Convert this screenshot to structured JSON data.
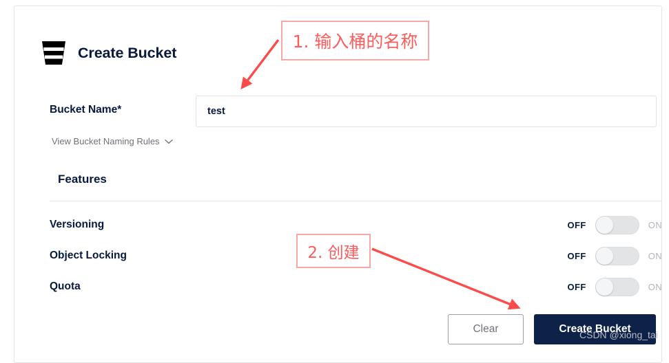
{
  "card": {
    "icon": "bucket-icon",
    "title": "Create Bucket"
  },
  "form": {
    "bucket_name": {
      "label": "Bucket Name*",
      "value": "test",
      "placeholder": ""
    },
    "naming_rules": {
      "label": "View Bucket Naming Rules",
      "chevron": "chevron-down-icon"
    }
  },
  "features": {
    "heading": "Features",
    "rows": [
      {
        "label": "Versioning",
        "off_label": "OFF",
        "on_label": "ON",
        "state": "off"
      },
      {
        "label": "Object Locking",
        "off_label": "OFF",
        "on_label": "ON",
        "state": "off"
      },
      {
        "label": "Quota",
        "off_label": "OFF",
        "on_label": "ON",
        "state": "off"
      }
    ]
  },
  "actions": {
    "clear_label": "Clear",
    "create_label": "Create Bucket"
  },
  "annotations": [
    {
      "text": "1. 输入桶的名称"
    },
    {
      "text": "2. 创建"
    }
  ],
  "watermark": "CSDN @xiong_tai",
  "colors": {
    "navy": "#0d2149",
    "text_navy": "#07193e",
    "annotation_red": "#fc5c5c",
    "annotation_border": "#f9a6a6",
    "toggle_track": "#e2e4e6",
    "muted_text": "#6e7178"
  }
}
